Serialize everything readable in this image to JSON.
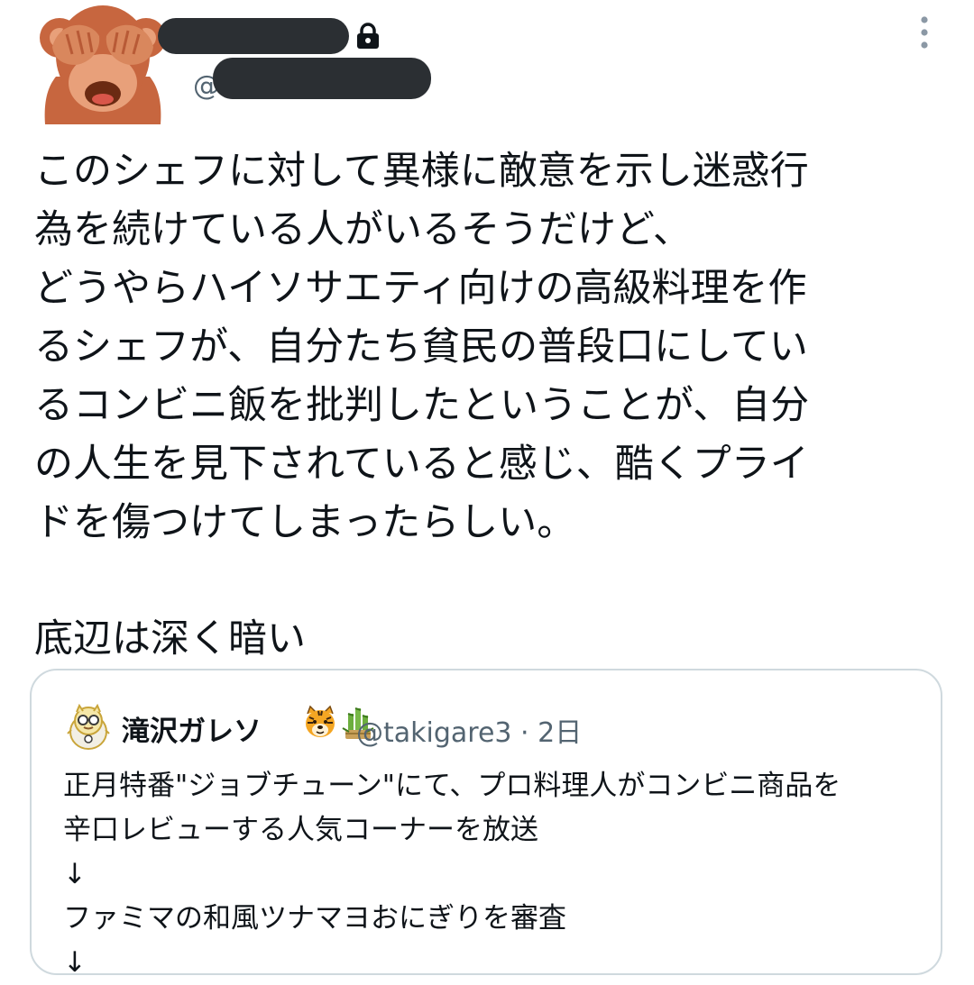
{
  "author": {
    "avatar_icon": "see-no-evil-monkey-icon",
    "protected_icon": "lock-icon",
    "handle_prefix": "@"
  },
  "menu_icon": "more-vertical-icon",
  "tweet": {
    "lines": [
      "このシェフに対して異様に敵意を示し迷惑行",
      "為を続けている人がいるそうだけど、",
      "どうやらハイソサエティ向けの高級料理を作",
      "るシェフが、自分たち貧民の普段口にしてい",
      "るコンビニ飯を批判したということが、自分",
      "の人生を見下されていると感じ、酷くプライ",
      "ドを傷つけてしまったらしい。"
    ],
    "closing": "底辺は深く暗い"
  },
  "quoted_tweet": {
    "avatar_icon": "tiger-mascot-avatar-icon",
    "name": "滝沢ガレソ",
    "name_emojis": [
      "tiger-face-icon",
      "kadomatsu-icon"
    ],
    "handle": "@takigare3",
    "time": "· 2日",
    "lines": [
      "正月特番\"ジョブチューン\"にて、プロ料理人がコンビニ商品を",
      "辛口レビューする人気コーナーを放送",
      "↓",
      "ファミマの和風ツナマヨおにぎりを審査",
      "↓"
    ]
  }
}
